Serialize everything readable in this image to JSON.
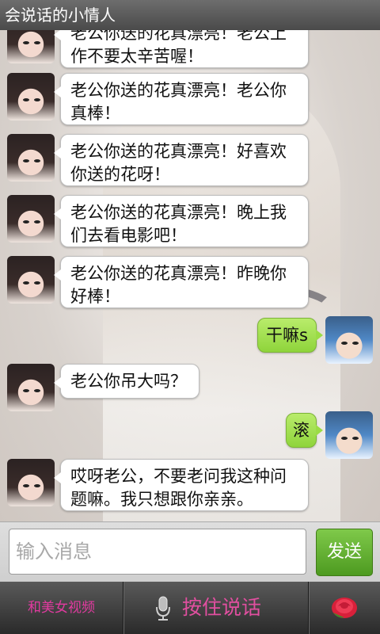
{
  "app": {
    "title": "会说话的小情人"
  },
  "messages": [
    {
      "from": "her",
      "text": "老公你送的花真漂亮！老公上作不要太辛苦喔！"
    },
    {
      "from": "her",
      "text": "老公你送的花真漂亮！老公你真棒！"
    },
    {
      "from": "her",
      "text": "老公你送的花真漂亮！好喜欢你送的花呀！"
    },
    {
      "from": "her",
      "text": "老公你送的花真漂亮！晚上我们去看电影吧！"
    },
    {
      "from": "her",
      "text": "老公你送的花真漂亮！昨晚你好棒！"
    },
    {
      "from": "me",
      "text": "干嘛s"
    },
    {
      "from": "her",
      "text": "老公你吊大吗？"
    },
    {
      "from": "me",
      "text": "滚"
    },
    {
      "from": "her",
      "text": "哎呀老公，不要老问我这种问题嘛。我只想跟你亲亲。"
    }
  ],
  "input": {
    "placeholder": "输入消息",
    "value": ""
  },
  "send_button": {
    "label": "发送"
  },
  "bottom": {
    "video_label": "和美女视频",
    "talk_label": "按住说话"
  },
  "icons": {
    "mic": "microphone-icon",
    "rose": "rose-icon"
  },
  "colors": {
    "send_green": "#5aa82a",
    "bubble_green": "#a8e156",
    "pink": "#e14fa0"
  }
}
